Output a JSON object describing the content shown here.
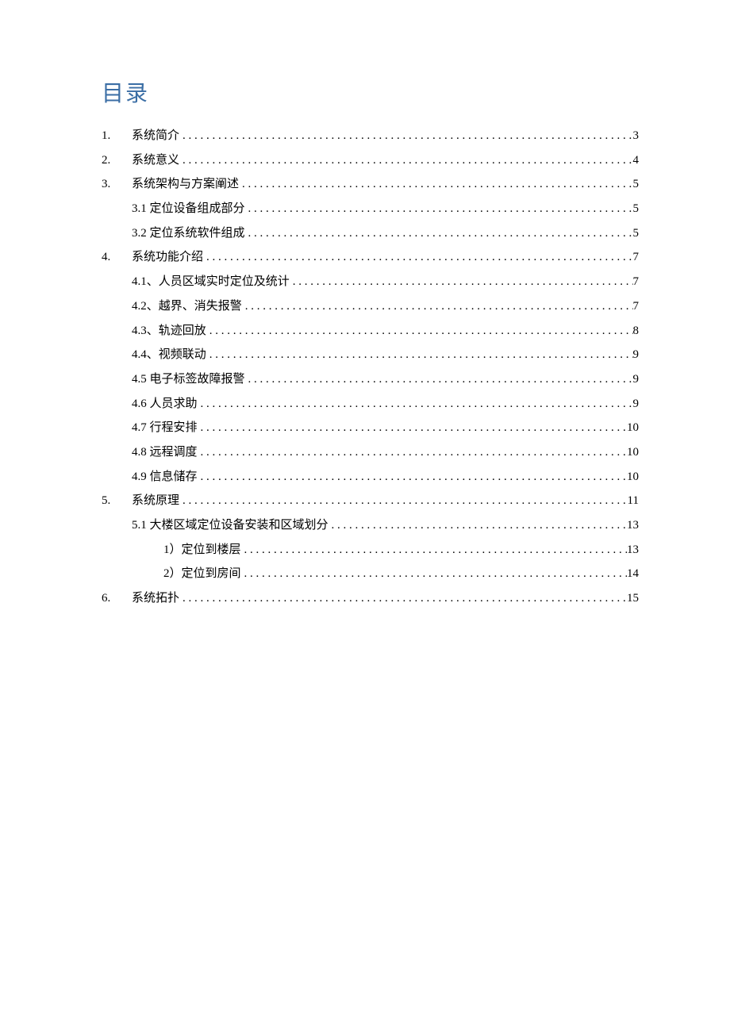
{
  "title": "目录",
  "entries": [
    {
      "level": 0,
      "number": "1.",
      "text": "系统简介",
      "page": "3"
    },
    {
      "level": 0,
      "number": "2.",
      "text": "系统意义",
      "page": "4"
    },
    {
      "level": 0,
      "number": "3.",
      "text": "系统架构与方案阐述",
      "page": "5"
    },
    {
      "level": 1,
      "number": "",
      "text": "3.1 定位设备组成部分",
      "page": "5"
    },
    {
      "level": 1,
      "number": "",
      "text": "3.2 定位系统软件组成",
      "page": "5"
    },
    {
      "level": 0,
      "number": "4.",
      "text": "系统功能介绍",
      "page": "7"
    },
    {
      "level": 1,
      "number": "",
      "text": "4.1、人员区域实时定位及统计",
      "page": "7"
    },
    {
      "level": 1,
      "number": "",
      "text": "4.2、越界、消失报警",
      "page": "7"
    },
    {
      "level": 1,
      "number": "",
      "text": "4.3、轨迹回放",
      "page": "8"
    },
    {
      "level": 1,
      "number": "",
      "text": "4.4、视频联动",
      "page": "9"
    },
    {
      "level": 1,
      "number": "",
      "text": "4.5 电子标签故障报警",
      "page": "9"
    },
    {
      "level": 1,
      "number": "",
      "text": "4.6 人员求助",
      "page": "9"
    },
    {
      "level": 1,
      "number": "",
      "text": "4.7 行程安排",
      "page": "10"
    },
    {
      "level": 1,
      "number": "",
      "text": "4.8 远程调度",
      "page": "10"
    },
    {
      "level": 1,
      "number": "",
      "text": "4.9 信息储存",
      "page": "10"
    },
    {
      "level": 0,
      "number": "5.",
      "text": "系统原理",
      "page": "11"
    },
    {
      "level": 1,
      "number": "",
      "text": "5.1 大楼区域定位设备安装和区域划分",
      "page": "13"
    },
    {
      "level": 2,
      "number": "",
      "text": "1）定位到楼层",
      "page": "13"
    },
    {
      "level": 2,
      "number": "",
      "text": "2）定位到房间",
      "page": "14"
    },
    {
      "level": 0,
      "number": "6.",
      "text": "系统拓扑",
      "page": "15"
    }
  ]
}
